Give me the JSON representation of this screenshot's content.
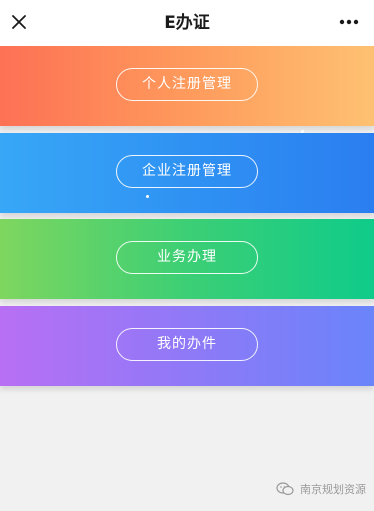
{
  "navbar": {
    "title": "E办证",
    "close_icon": "close-icon",
    "more_icon": "more-dots-icon"
  },
  "menu": [
    {
      "label": "个人注册管理",
      "colors": [
        "#fd7155",
        "#fec172"
      ]
    },
    {
      "label": "企业注册管理",
      "colors": [
        "#38a7f6",
        "#2b7ef0"
      ]
    },
    {
      "label": "业务办理",
      "colors": [
        "#7ed65f",
        "#0fcb8a"
      ]
    },
    {
      "label": "我的办件",
      "colors": [
        "#b86ff4",
        "#6a84fa"
      ]
    }
  ],
  "watermark": {
    "icon": "wechat-icon",
    "text": "南京规划资源"
  }
}
